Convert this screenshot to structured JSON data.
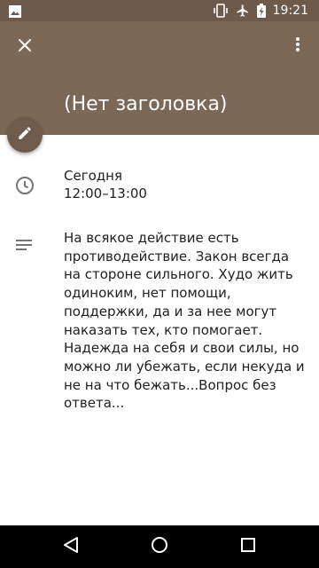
{
  "status_bar": {
    "time": "19:21",
    "icons": [
      "image-notification-icon",
      "vibrate-icon",
      "airplane-mode-icon",
      "battery-charging-icon"
    ]
  },
  "header": {
    "close_icon": "close-icon",
    "more_icon": "more-vert-icon",
    "title": "(Нет заголовка)"
  },
  "fab": {
    "icon": "pencil-edit-icon"
  },
  "when": {
    "icon": "clock-icon",
    "day": "Сегодня",
    "time_range": "12:00–13:00"
  },
  "description": {
    "icon": "notes-icon",
    "text": "На всякое действие есть противодействие. Закон всегда на стороне сильного. Худо жить одиноким, нет помощи, поддержки, да и за нее могут наказать тех, кто помогает. Надежда на себя и свои силы, но можно ли убежать, если некуда и не на что бежать...Вопрос без ответа..."
  },
  "nav_bar": {
    "buttons": [
      "back-icon",
      "home-icon",
      "recents-icon"
    ]
  },
  "colors": {
    "header_background": "#7c6856",
    "status_background": "#6d5a4b",
    "fab_background": "#6f5b4c",
    "text_primary": "#212121",
    "icon_grey": "#757575"
  }
}
